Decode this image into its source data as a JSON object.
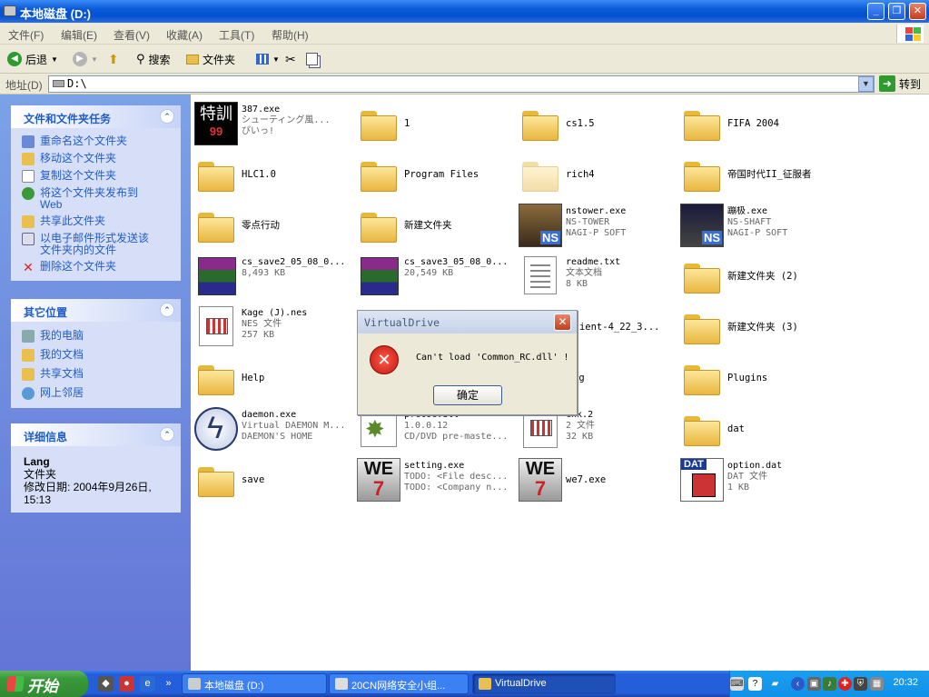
{
  "window": {
    "title": "本地磁盘  (D:)",
    "buttons": [
      "_",
      "❐",
      "✕"
    ]
  },
  "menu": [
    "文件(F)",
    "编辑(E)",
    "查看(V)",
    "收藏(A)",
    "工具(T)",
    "帮助(H)"
  ],
  "toolbar": {
    "back": "后退",
    "search": "搜索",
    "folders": "文件夹"
  },
  "address": {
    "label": "地址(D)",
    "value": "D:\\",
    "go": "转到"
  },
  "tasks_panel": {
    "title": "文件和文件夹任务",
    "items": [
      "重命名这个文件夹",
      "移动这个文件夹",
      "复制这个文件夹",
      "将这个文件夹发布到 Web",
      "共享此文件夹",
      "以电子邮件形式发送该文件夹内的文件",
      "删除这个文件夹"
    ]
  },
  "places_panel": {
    "title": "其它位置",
    "items": [
      "我的电脑",
      "我的文档",
      "共享文档",
      "网上邻居"
    ]
  },
  "details_panel": {
    "title": "详细信息",
    "name": "Lang",
    "type": "文件夹",
    "modified": "修改日期: 2004年9月26日, 15:13"
  },
  "files": [
    {
      "icon": "exe-387-icon",
      "line1": "387.exe",
      "line2": "シューティング風...",
      "line3": "ぴいっ!"
    },
    {
      "icon": "folder-icon",
      "line1": "1"
    },
    {
      "icon": "folder-icon",
      "line1": "cs1.5"
    },
    {
      "icon": "folder-icon",
      "line1": "FIFA 2004"
    },
    {
      "icon": "folder-icon",
      "line1": "HLC1.0"
    },
    {
      "icon": "folder-icon",
      "line1": "Program Files"
    },
    {
      "icon": "folder-icon",
      "line1": "rich4"
    },
    {
      "icon": "folder-icon",
      "line1": "帝国时代II_征服者"
    },
    {
      "icon": "folder-icon",
      "line1": "零点行动"
    },
    {
      "icon": "folder-icon",
      "line1": "新建文件夹"
    },
    {
      "icon": "ns-tower-icon",
      "line1": "nstower.exe",
      "line2": "NS-TOWER",
      "line3": "NAGI-P SOFT"
    },
    {
      "icon": "ns-shaft-icon",
      "line1": "蹦极.exe",
      "line2": "NS-SHAFT",
      "line3": "NAGI-P SOFT"
    },
    {
      "icon": "rar-icon",
      "line1": "cs_save2_05_08_0...",
      "line2": "8,493 KB"
    },
    {
      "icon": "rar-icon",
      "line1": "cs_save3_05_08_0...",
      "line2": "20,549 KB"
    },
    {
      "icon": "text-document-icon",
      "line1": "readme.txt",
      "line2": "文本文档",
      "line3": "8 KB"
    },
    {
      "icon": "folder-icon",
      "line1": "新建文件夹 (2)"
    },
    {
      "icon": "nes-file-icon",
      "line1": "Kage (J).nes",
      "line2": "NES 文件",
      "line3": "257 KB"
    },
    {
      "icon": "",
      "line1": ""
    },
    {
      "icon": "exe-icon",
      "line1": "-client-4_22_3..."
    },
    {
      "icon": "folder-icon",
      "line1": "新建文件夹 (3)"
    },
    {
      "icon": "folder-icon",
      "line1": "Help"
    },
    {
      "icon": "",
      "line1": ""
    },
    {
      "icon": "exe-icon",
      "line1": "ng"
    },
    {
      "icon": "folder-icon",
      "line1": "Plugins"
    },
    {
      "icon": "daemon-icon",
      "line1": "daemon.exe",
      "line2": "Virtual DAEMON M...",
      "line3": "DAEMON'S HOME"
    },
    {
      "icon": "dll-gear-icon",
      "line1": "pfctoc.dll",
      "line2": "1.0.0.12",
      "line3": "CD/DVD pre-maste..."
    },
    {
      "icon": "nes-file-icon",
      "line1": "cnk.2",
      "line2": "2 文件",
      "line3": "32 KB"
    },
    {
      "icon": "folder-icon",
      "line1": "dat"
    },
    {
      "icon": "folder-icon",
      "line1": "save"
    },
    {
      "icon": "we7-icon",
      "line1": "setting.exe",
      "line2": "TODO: <File desc...",
      "line3": "TODO: <Company n..."
    },
    {
      "icon": "we7-icon",
      "line1": "we7.exe"
    },
    {
      "icon": "dat-file-icon",
      "line1": "option.dat",
      "line2": "DAT 文件",
      "line3": "1 KB"
    }
  ],
  "dialog": {
    "title": "VirtualDrive",
    "message": "Can't load 'Common_RC.dll' !",
    "ok": "确定"
  },
  "taskbar": {
    "start": "开始",
    "tasks": [
      "本地磁盘  (D:)",
      "20CN网络安全小组...",
      "VirtualDrive"
    ],
    "clock": "20:32"
  },
  "colors": {
    "sidebar": "#6375d6",
    "panel": "#d6dff7",
    "link": "#215dc6",
    "taskbar": "#245edb",
    "start": "#3a9a3a"
  }
}
